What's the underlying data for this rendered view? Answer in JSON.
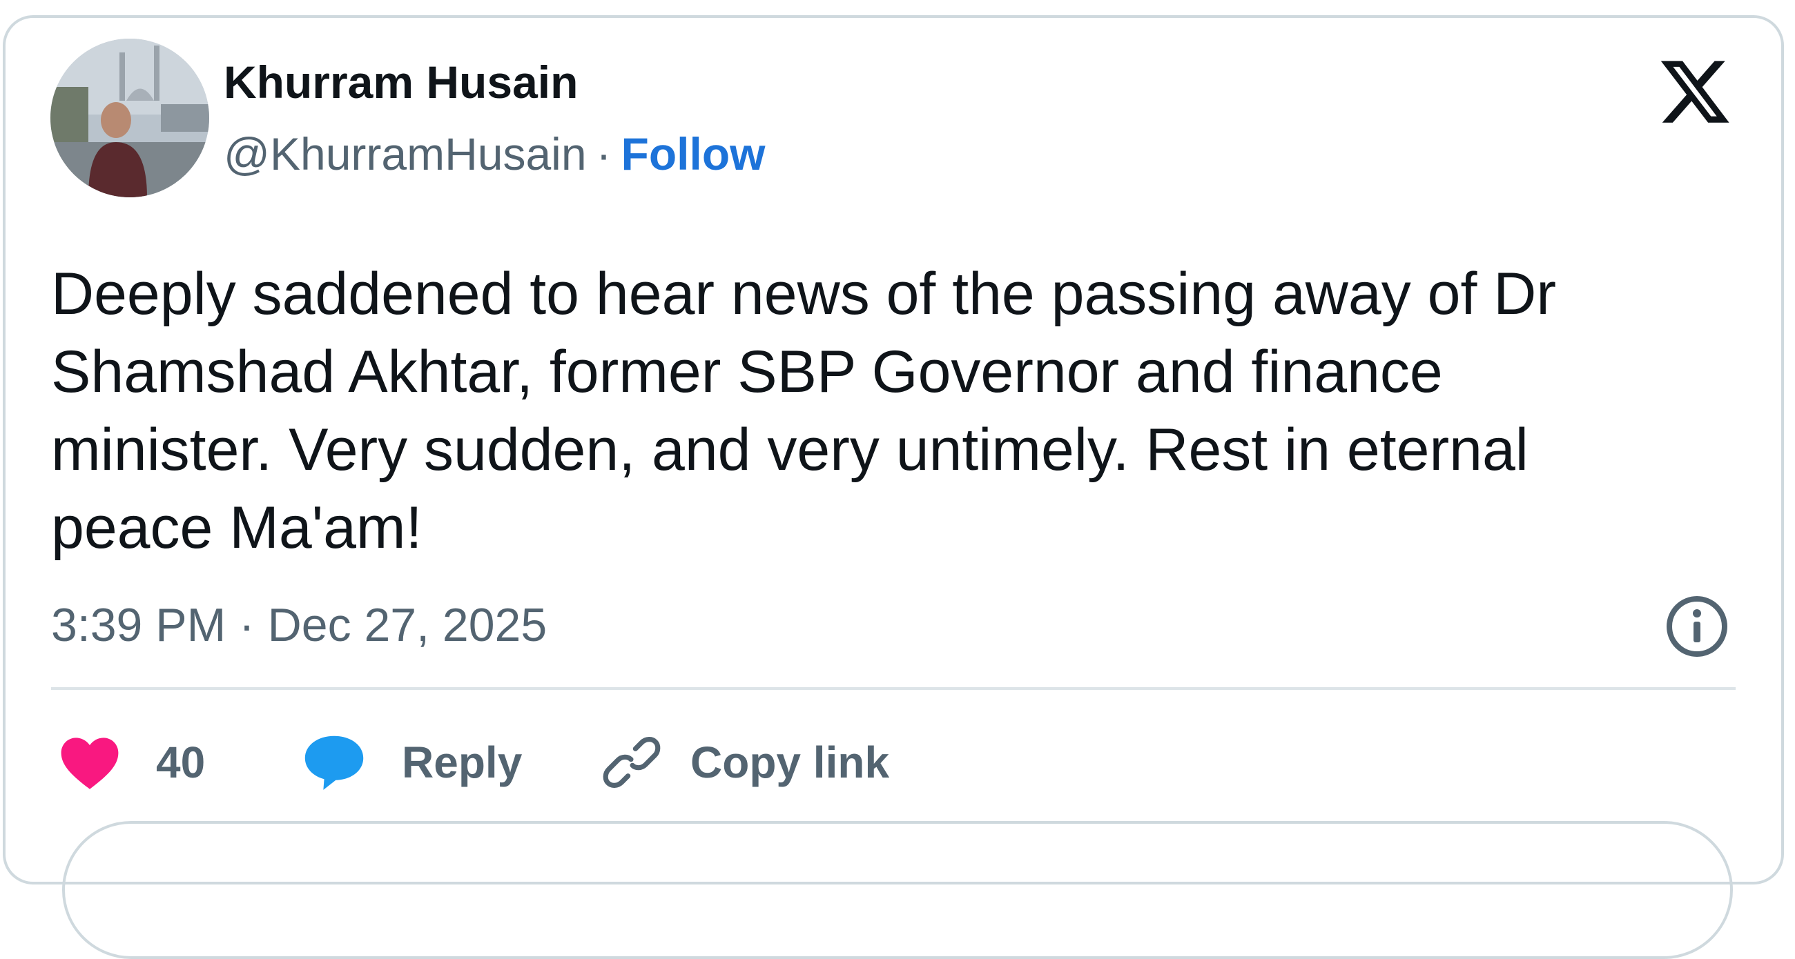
{
  "author": {
    "display_name": "Khurram Husain",
    "handle": "@KhurramHusain",
    "separator": "·",
    "follow_label": "Follow"
  },
  "tweet": {
    "text": "Deeply saddened to hear news of the passing away of Dr\nShamshad Akhtar, former SBP Governor and finance\nminister.  Very sudden, and very untimely. Rest in eternal\npeace Ma'am!",
    "timestamp": "3:39 PM · Dec 27, 2025"
  },
  "actions": {
    "likes_count": "40",
    "reply_label": "Reply",
    "copy_link_label": "Copy link"
  },
  "icons": {
    "brand": "x-logo-icon",
    "info": "info-icon",
    "like": "heart-icon",
    "reply": "speech-bubble-icon",
    "copy": "link-icon"
  },
  "colors": {
    "follow": "#1d73d9",
    "like": "#f91880",
    "reply": "#1d9bf0",
    "muted": "#536471",
    "text": "#0f1419",
    "border": "#cfd9de"
  }
}
